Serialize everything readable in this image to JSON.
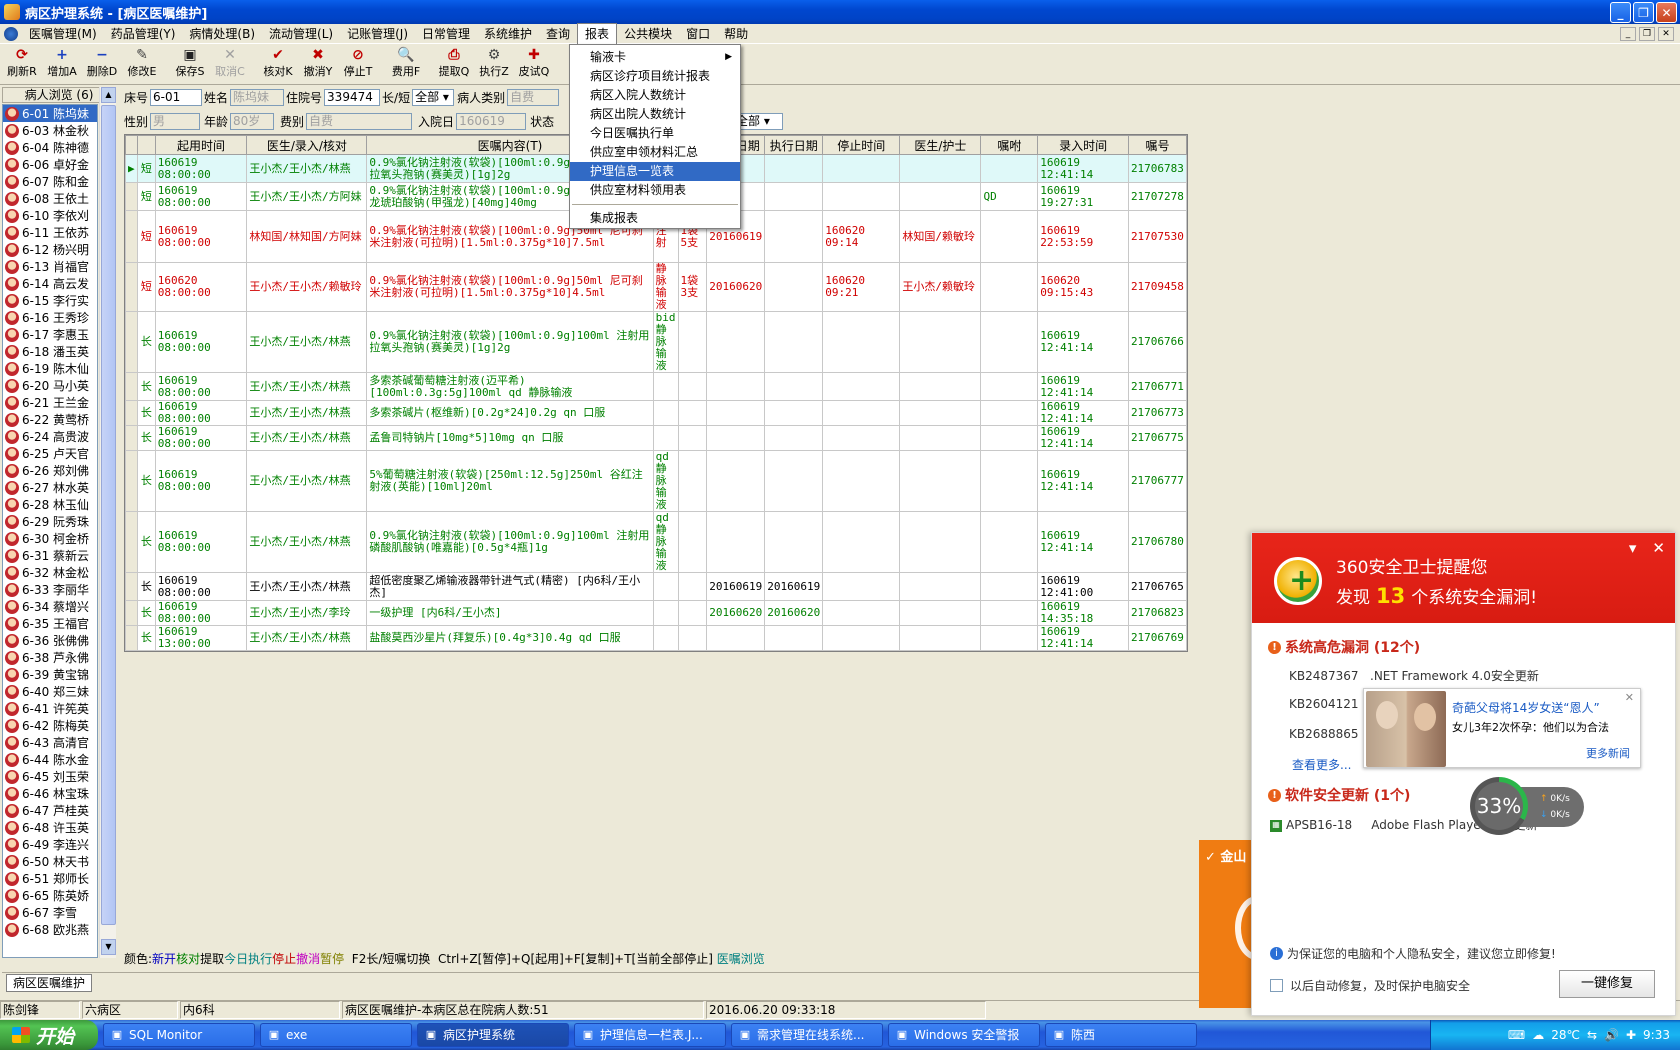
{
  "window": {
    "title": "病区护理系统 - [病区医嘱维护]"
  },
  "menu": [
    "医嘱管理(M)",
    "药品管理(Y)",
    "病情处理(B)",
    "流动管理(L)",
    "记账管理(J)",
    "日常管理",
    "系统维护",
    "查询",
    "报表",
    "公共模块",
    "窗口",
    "帮助"
  ],
  "open_menu": "报表",
  "dropdown": {
    "items": [
      "输液卡",
      "病区诊疗项目统计报表",
      "病区入院人数统计",
      "病区出院人数统计",
      "今日医嘱执行单",
      "供应室申领材料汇总",
      "护理信息一览表",
      "供应室材料领用表",
      "集成报表"
    ],
    "highlighted": "护理信息一览表",
    "submenu_item": "输液卡"
  },
  "toolbar": [
    {
      "label": "刷新R",
      "icon": "refresh-icon",
      "glyph": "⟳",
      "color": "#c00000",
      "enabled": true
    },
    {
      "label": "增加A",
      "icon": "add-icon",
      "glyph": "+",
      "color": "#1a40c0",
      "enabled": true
    },
    {
      "label": "删除D",
      "icon": "delete-icon",
      "glyph": "−",
      "color": "#1a40c0",
      "enabled": true
    },
    {
      "label": "修改E",
      "icon": "edit-icon",
      "glyph": "✎",
      "color": "#444",
      "enabled": true
    },
    {
      "label": "保存S",
      "icon": "save-icon",
      "glyph": "▣",
      "color": "#222",
      "enabled": true
    },
    {
      "label": "取消C",
      "icon": "cancel-icon",
      "glyph": "✕",
      "color": "#a0a0a0",
      "enabled": false
    },
    {
      "label": "核对K",
      "icon": "check-icon",
      "glyph": "✔",
      "color": "#c00000",
      "enabled": true
    },
    {
      "label": "撤消Y",
      "icon": "undo-icon",
      "glyph": "✖",
      "color": "#c00000",
      "enabled": true
    },
    {
      "label": "停止T",
      "icon": "stop-icon",
      "glyph": "⊘",
      "color": "#c00000",
      "enabled": true
    },
    {
      "label": "费用F",
      "icon": "fee-icon",
      "glyph": "🔍",
      "color": "#444",
      "enabled": true
    },
    {
      "label": "提取Q",
      "icon": "print-icon",
      "glyph": "⎙",
      "color": "#c00000",
      "enabled": true
    },
    {
      "label": "执行Z",
      "icon": "execute-icon",
      "glyph": "⚙",
      "color": "#444",
      "enabled": true
    },
    {
      "label": "皮试Q",
      "icon": "skintest-icon",
      "glyph": "✚",
      "color": "#c00000",
      "enabled": true
    }
  ],
  "patient_browser": {
    "header": "病人浏览 (6)",
    "patients": [
      "6-01 陈坞妹",
      "6-03 林金秋",
      "6-04 陈神德",
      "6-06 卓好金",
      "6-07 陈和金",
      "6-08 王依土",
      "6-10 李依刈",
      "6-11 王依苏",
      "6-12 杨兴明",
      "6-13 肖福官",
      "6-14 高云发",
      "6-15 李行实",
      "6-16 王秀珍",
      "6-17 李惠玉",
      "6-18 潘玉英",
      "6-19 陈木仙",
      "6-20 马小英",
      "6-21 王兰金",
      "6-22 黄莺桥",
      "6-24 高贵波",
      "6-25 卢天官",
      "6-26 郑刘佛",
      "6-27 林水英",
      "6-28 林玉仙",
      "6-29 阮秀珠",
      "6-30 柯金桥",
      "6-31 蔡新云",
      "6-32 林金松",
      "6-33 李丽华",
      "6-34 蔡增兴",
      "6-35 王福官",
      "6-36 张佛佛",
      "6-38 芦永佛",
      "6-39 黄宝锦",
      "6-40 郑三妹",
      "6-41 许筅英",
      "6-42 陈梅英",
      "6-43 高清官",
      "6-44 陈水金",
      "6-45 刘玉荣",
      "6-46 林宝珠",
      "6-47 芦桂英",
      "6-48 许玉英",
      "6-49 李连兴",
      "6-50 林天书",
      "6-51 郑师长",
      "6-65 陈英娇",
      "6-67 李雪",
      "6-68 欧兆燕"
    ],
    "selected_index": 0
  },
  "form": {
    "bed_label": "床号",
    "bed": "6-01",
    "name_label": "姓名",
    "name": "陈坞妹",
    "inpatient_label": "住院号",
    "inpatient": "339474",
    "type_label": "长/短",
    "type_value": "全部",
    "category_label": "病人类别",
    "category": "自费",
    "sex_label": "性别",
    "sex": "男",
    "age_label": "年龄",
    "age": "80岁",
    "fee_label": "费别",
    "fee": "自费",
    "admit_label": "入院日",
    "admit": "160619",
    "status_label": "状态",
    "status_value": "全部"
  },
  "orders_table": {
    "columns": [
      "",
      "",
      "起用时间",
      "医生/录入/核对",
      "医嘱内容(T)",
      "",
      "",
      "用药日期",
      "执行日期",
      "停止时间",
      "医生/护士",
      "嘱咐",
      "录入时间",
      "嘱号"
    ],
    "rows": [
      {
        "c": "g",
        "sel": true,
        "lh": 2,
        "t": "短",
        "start": "160619 08:00:00",
        "doc": "王小杰/王小杰/林燕",
        "content": "0.9%氯化钠注射液(软袋)[100ml:0.9g]100ml 注射用拉氧头孢钠(赛美灵)[1g]2g",
        "usage": "",
        "qty": "",
        "useday": "",
        "execday": "",
        "stop": "",
        "nurse": "",
        "note": "",
        "entry": "160619 12:41:14",
        "no": "21706783"
      },
      {
        "c": "g",
        "sel": false,
        "lh": 2,
        "t": "短",
        "start": "160619 08:00:00",
        "doc": "王小杰/王小杰/方阿妹",
        "content": "0.9%氯化钠注射液(软袋)[100ml:0.9g]100ml 甲泼尼龙琥珀酸钠(甲强龙)[40mg]40mg",
        "usage": "",
        "qty": "",
        "useday": "",
        "execday": "",
        "stop": "",
        "nurse": "",
        "note": "QD",
        "entry": "160619 19:27:31",
        "no": "21707278"
      },
      {
        "c": "r",
        "sel": false,
        "lh": 4,
        "t": "短",
        "start": "160619 08:00:00",
        "doc": "林知国/林知国/方阿妹",
        "content": "0.9%氯化钠注射液(软袋)[100ml:0.9g]50ml 尼可刹米注射液(可拉明)[1.5ml:0.375g*10]7.5ml",
        "usage": "注射",
        "qty": "1袋 5支",
        "useday": "20160619",
        "execday": "",
        "stop": "160620 09:14",
        "nurse": "林知国/赖敏玲",
        "note": "",
        "entry": "160619 22:53:59",
        "no": "21707530"
      },
      {
        "c": "r",
        "sel": false,
        "lh": 3,
        "t": "短",
        "start": "160620 08:00:00",
        "doc": "王小杰/王小杰/赖敏玲",
        "content": "0.9%氯化钠注射液(软袋)[100ml:0.9g]50ml 尼可刹米注射液(可拉明)[1.5ml:0.375g*10]4.5ml",
        "usage": "静脉输液",
        "qty": "1袋 3支",
        "useday": "20160620",
        "execday": "",
        "stop": "160620 09:21",
        "nurse": "王小杰/赖敏玲",
        "note": "",
        "entry": "160620 09:15:43",
        "no": "21709458"
      },
      {
        "c": "g",
        "sel": false,
        "lh": 2,
        "t": "长",
        "start": "160619 08:00:00",
        "doc": "王小杰/王小杰/林燕",
        "content": "0.9%氯化钠注射液(软袋)[100ml:0.9g]100ml 注射用拉氧头孢钠(赛美灵)[1g]2g",
        "usage": "bid 静脉输液",
        "qty": "",
        "useday": "",
        "execday": "",
        "stop": "",
        "nurse": "",
        "note": "",
        "entry": "160619 12:41:14",
        "no": "21706766"
      },
      {
        "c": "g",
        "sel": false,
        "lh": 2,
        "t": "长",
        "start": "160619 08:00:00",
        "doc": "王小杰/王小杰/林燕",
        "content": "多索茶碱葡萄糖注射液(迈平希)[100ml:0.3g:5g]100ml qd 静脉输液",
        "usage": "",
        "qty": "",
        "useday": "",
        "execday": "",
        "stop": "",
        "nurse": "",
        "note": "",
        "entry": "160619 12:41:14",
        "no": "21706771"
      },
      {
        "c": "g",
        "sel": false,
        "lh": 1,
        "t": "长",
        "start": "160619 08:00:00",
        "doc": "王小杰/王小杰/林燕",
        "content": "多索茶碱片(枢维新)[0.2g*24]0.2g qn 口服",
        "usage": "",
        "qty": "",
        "useday": "",
        "execday": "",
        "stop": "",
        "nurse": "",
        "note": "",
        "entry": "160619 12:41:14",
        "no": "21706773"
      },
      {
        "c": "g",
        "sel": false,
        "lh": 1,
        "t": "长",
        "start": "160619 08:00:00",
        "doc": "王小杰/王小杰/林燕",
        "content": "孟鲁司特钠片[10mg*5]10mg qn 口服",
        "usage": "",
        "qty": "",
        "useday": "",
        "execday": "",
        "stop": "",
        "nurse": "",
        "note": "",
        "entry": "160619 12:41:14",
        "no": "21706775"
      },
      {
        "c": "g",
        "sel": false,
        "lh": 2,
        "t": "长",
        "start": "160619 08:00:00",
        "doc": "王小杰/王小杰/林燕",
        "content": "5%葡萄糖注射液(软袋)[250ml:12.5g]250ml 谷红注射液(英能)[10ml]20ml",
        "usage": "qd 静脉输液",
        "qty": "",
        "useday": "",
        "execday": "",
        "stop": "",
        "nurse": "",
        "note": "",
        "entry": "160619 12:41:14",
        "no": "21706777"
      },
      {
        "c": "g",
        "sel": false,
        "lh": 2,
        "t": "长",
        "start": "160619 08:00:00",
        "doc": "王小杰/王小杰/林燕",
        "content": "0.9%氯化钠注射液(软袋)[100ml:0.9g]100ml 注射用磷酸肌酸钠(唯嘉能)[0.5g*4瓶]1g",
        "usage": "qd 静脉输液",
        "qty": "",
        "useday": "",
        "execday": "",
        "stop": "",
        "nurse": "",
        "note": "",
        "entry": "160619 12:41:14",
        "no": "21706780"
      },
      {
        "c": "k",
        "sel": false,
        "lh": 2,
        "t": "长",
        "start": "160619 08:00:00",
        "doc": "王小杰/王小杰/林燕",
        "content": "超低密度聚乙烯输液器带针进气式(精密) [内6科/王小杰]",
        "usage": "",
        "qty": "",
        "useday": "20160619",
        "execday": "20160619",
        "stop": "",
        "nurse": "",
        "note": "",
        "entry": "160619 12:41:00",
        "no": "21706765"
      },
      {
        "c": "g",
        "sel": false,
        "lh": 1,
        "t": "长",
        "start": "160619 08:00:00",
        "doc": "王小杰/王小杰/李玲",
        "content": "一级护理 [内6科/王小杰]",
        "usage": "",
        "qty": "",
        "useday": "20160620",
        "execday": "20160620",
        "stop": "",
        "nurse": "",
        "note": "",
        "entry": "160619 14:35:18",
        "no": "21706823"
      },
      {
        "c": "g",
        "sel": false,
        "lh": 1,
        "t": "长",
        "start": "160619 13:00:00",
        "doc": "王小杰/王小杰/林燕",
        "content": "盐酸莫西沙星片(拜复乐)[0.4g*3]0.4g qd 口服",
        "usage": "",
        "qty": "",
        "useday": "",
        "execday": "",
        "stop": "",
        "nurse": "",
        "note": "",
        "entry": "160619 12:41:14",
        "no": "21706769"
      }
    ]
  },
  "legend": [
    {
      "text": "颜色:",
      "color": "#000000"
    },
    {
      "text": "新开",
      "color": "#0000c0"
    },
    {
      "text": "核对",
      "color": "#008000"
    },
    {
      "text": "提取",
      "color": "#000000"
    },
    {
      "text": "今日执行",
      "color": "#008080"
    },
    {
      "text": "停止",
      "color": "#c00000"
    },
    {
      "text": "撤消",
      "color": "#c000c0"
    },
    {
      "text": "暂停",
      "color": "#808000"
    },
    {
      "text": "  F2长/短嘱切换  Ctrl+Z[暂停]+Q[起用]+F[复制]+T[当前全部停止] ",
      "color": "#000000"
    },
    {
      "text": "医嘱浏览",
      "color": "#008080"
    }
  ],
  "doc_tab": "病区医嘱维护",
  "statusbar": [
    "陈剑锋",
    "六病区",
    "内6科",
    "病区医嘱维护-本病区总在院病人数:51",
    "2016.06.20 09:33:18"
  ],
  "popup_360": {
    "title": "360安全卫士提醒您",
    "line2_pre": "发现",
    "count": "13",
    "line2_post": "个系统安全漏洞!",
    "section1": "系统高危漏洞 (12个)",
    "kbs": [
      {
        "id": "KB2487367",
        "desc": ".NET Framework 4.0安全更新"
      },
      {
        "id": "KB2604121",
        "desc": ""
      },
      {
        "id": "KB2688865",
        "desc": ""
      }
    ],
    "more": "查看更多...",
    "news_title": "奇葩父母将14岁女送“恩人”",
    "news_body": "女儿3年2次怀孕：他们以为合法",
    "news_more": "更多新闻",
    "section2": "软件安全更新 (1个)",
    "sw_id": "APSB16-18",
    "sw_desc": "Adobe Flash Player 安全更新",
    "notice": "为保证您的电脑和个人隐私安全，建议您立即修复!",
    "auto_fix": "以后自动修复，及时保护电脑安全",
    "fix_button": "一键修复",
    "speed_percent": "33%",
    "speed_up": "0K/s",
    "speed_down": "0K/s"
  },
  "kingsoft_label": "金山",
  "taskbar": {
    "start": "开始",
    "tasks": [
      {
        "label": "SQL Monitor",
        "icon": "sql-monitor-icon",
        "active": false
      },
      {
        "label": "exe",
        "icon": "folder-icon",
        "active": false
      },
      {
        "label": "病区护理系统",
        "icon": "app-icon",
        "active": true
      },
      {
        "label": "护理信息一栏表.J...",
        "icon": "document-icon",
        "active": false
      },
      {
        "label": "需求管理在线系统...",
        "icon": "ie-icon",
        "active": false
      },
      {
        "label": "Windows 安全警报",
        "icon": "shield-icon",
        "active": false
      },
      {
        "label": "陈西",
        "icon": "chat-icon",
        "active": false
      }
    ],
    "temperature": "28℃",
    "clock": "9:33"
  }
}
